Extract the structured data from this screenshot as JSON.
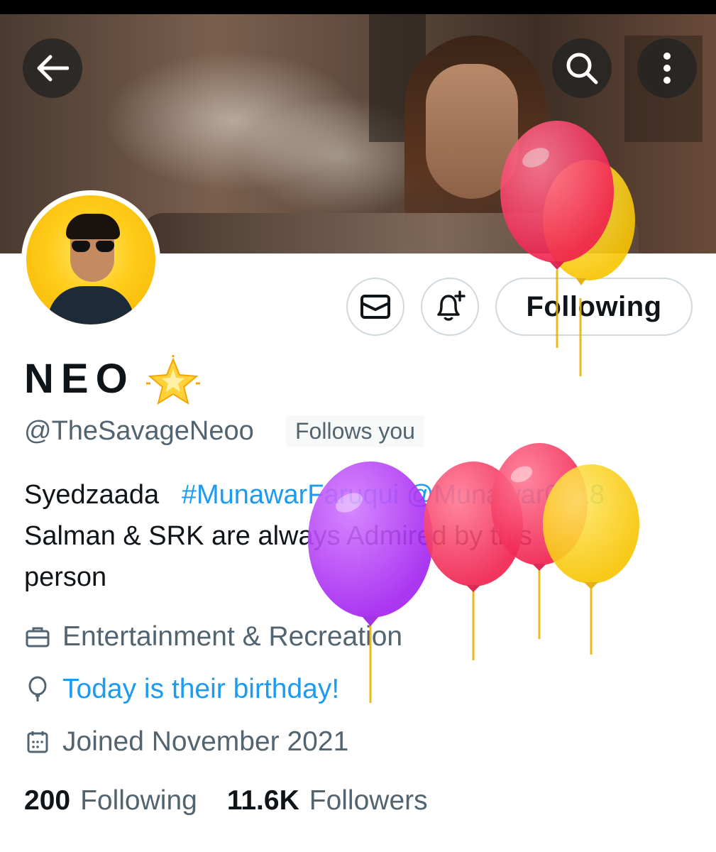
{
  "header": {
    "back_icon": "arrow-left-icon",
    "search_icon": "search-icon",
    "more_icon": "more-vertical-icon"
  },
  "profile": {
    "display_name": "NEO",
    "name_badge": "glowing-star-emoji",
    "handle": "@TheSavageNeoo",
    "follows_you": "Follows you",
    "bio": {
      "prefix": "Syedzaada",
      "hashtag": "#MunawarFaruqui",
      "mention": "@Munawar0018",
      "line2": "Salman & SRK are always Admired by this",
      "line3": "person"
    }
  },
  "actions": {
    "message_icon": "envelope-icon",
    "notify_icon": "bell-plus-icon",
    "following_label": "Following"
  },
  "meta": {
    "category": "Entertainment & Recreation",
    "birthday": "Today is their birthday!",
    "joined": "Joined November 2021"
  },
  "stats": {
    "following_count": "200",
    "following_label": "Following",
    "followers_count": "11.6K",
    "followers_label": "Followers"
  },
  "colors": {
    "accent_blue": "#1d9bf0",
    "secondary_text": "#536471",
    "primary_text": "#0f1419"
  }
}
